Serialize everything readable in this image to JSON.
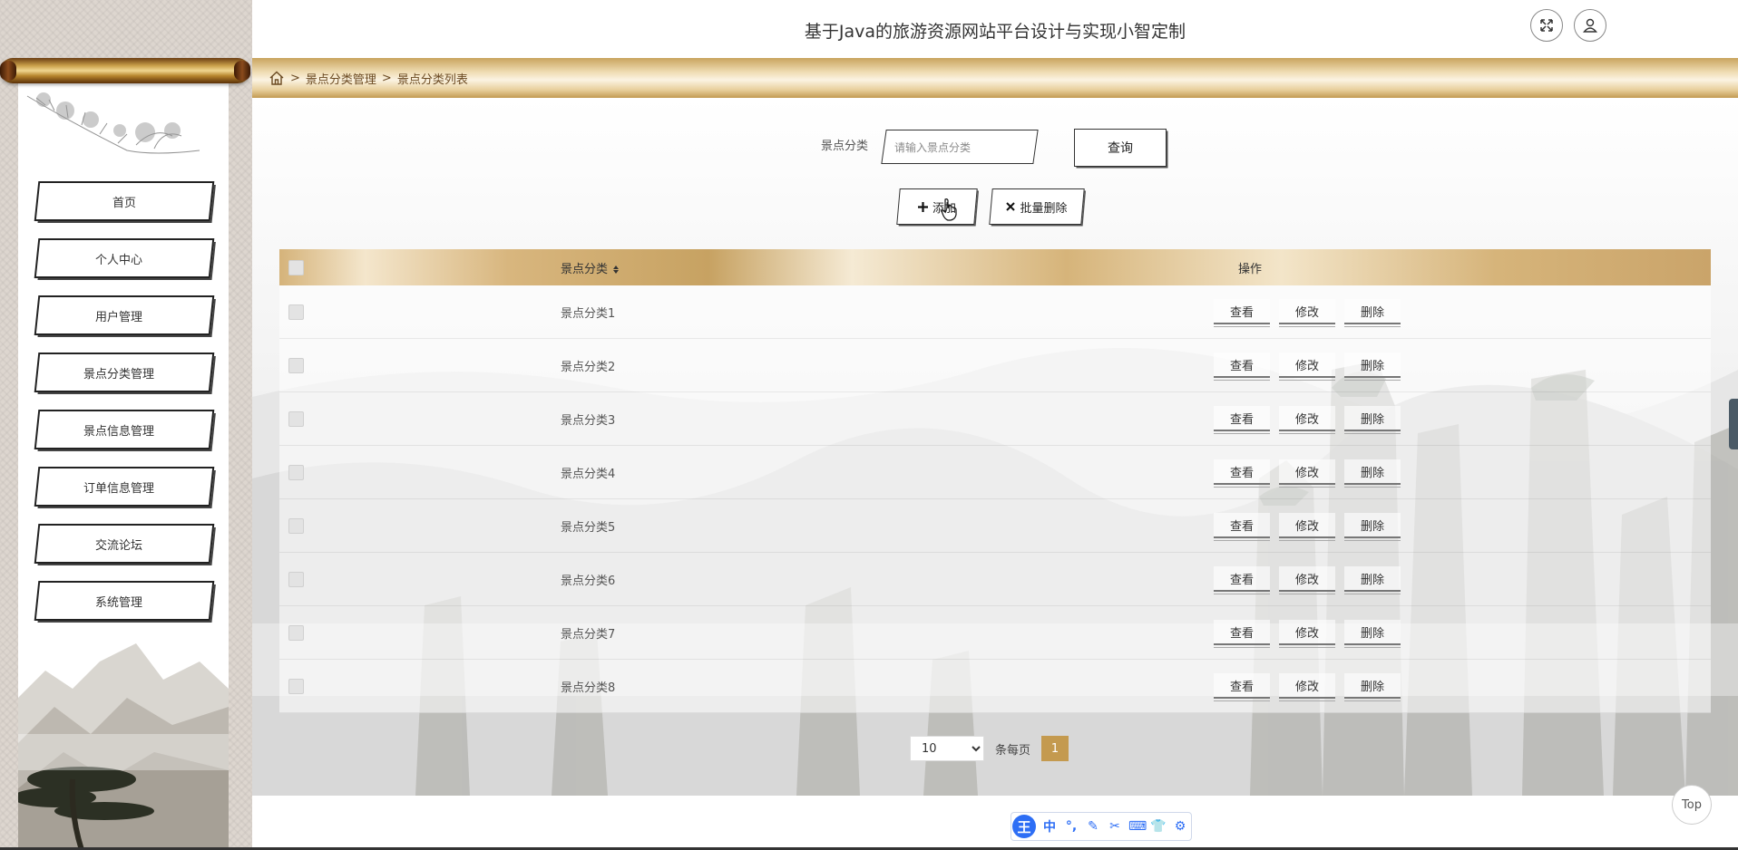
{
  "header": {
    "title": "基于Java的旅游资源网站平台设计与实现小智定制"
  },
  "breadcrumb": {
    "items": [
      "景点分类管理",
      "景点分类列表"
    ],
    "separator": ">"
  },
  "sidebar": {
    "items": [
      {
        "label": "首页",
        "has_caret": false
      },
      {
        "label": "个人中心",
        "has_caret": true
      },
      {
        "label": "用户管理",
        "has_caret": true
      },
      {
        "label": "景点分类管理",
        "has_caret": true
      },
      {
        "label": "景点信息管理",
        "has_caret": true
      },
      {
        "label": "订单信息管理",
        "has_caret": true
      },
      {
        "label": "交流论坛",
        "has_caret": true
      },
      {
        "label": "系统管理",
        "has_caret": true
      }
    ]
  },
  "search": {
    "label": "景点分类",
    "placeholder": "请输入景点分类",
    "value": "",
    "button": "查询"
  },
  "actions": {
    "add": "添加",
    "batch_delete": "批量删除"
  },
  "table": {
    "columns": [
      "景点分类",
      "操作"
    ],
    "rows": [
      "景点分类1",
      "景点分类2",
      "景点分类3",
      "景点分类4",
      "景点分类5",
      "景点分类6",
      "景点分类7",
      "景点分类8"
    ],
    "ops": [
      "查看",
      "修改",
      "删除"
    ]
  },
  "pagination": {
    "page_size": "10",
    "page_size_options": [
      "10"
    ],
    "per_page_label": "条每页",
    "current_page": "1"
  },
  "ime_bar": {
    "logo": "王",
    "items": [
      "中",
      "°,",
      "✎",
      "✂",
      "⌨",
      "👕",
      "⚙"
    ]
  },
  "top_button": "Top",
  "colors": {
    "accent": "#c49a4f",
    "ime_blue": "#2d6ef5"
  }
}
